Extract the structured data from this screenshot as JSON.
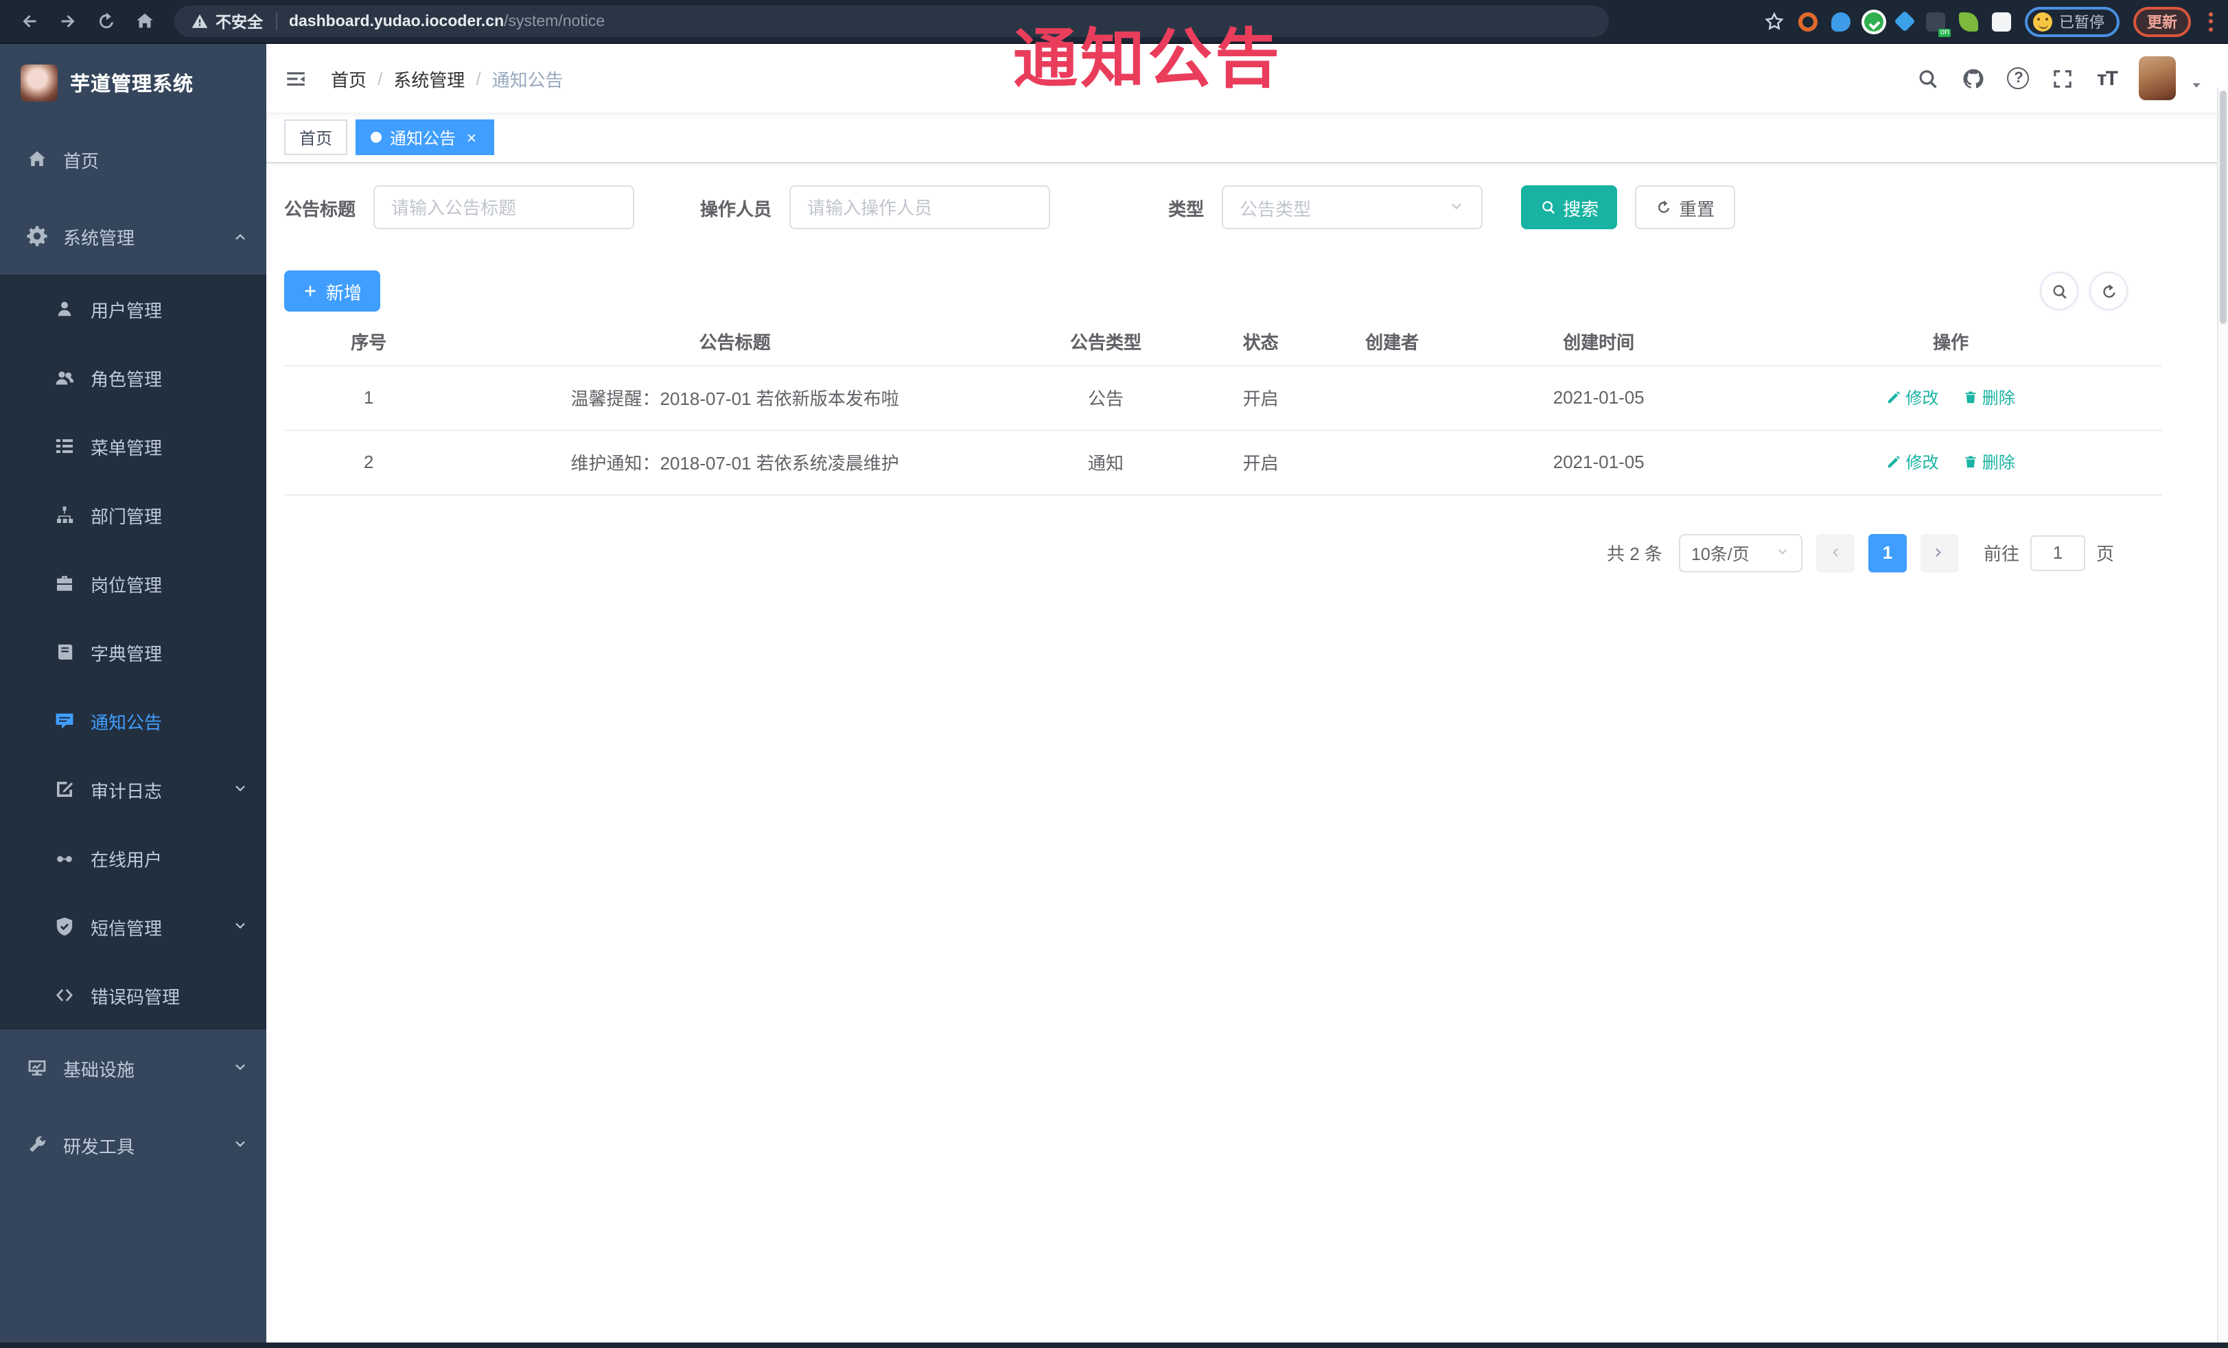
{
  "browser": {
    "security_label": "不安全",
    "url_host": "dashboard.yudao.iocoder.cn",
    "url_path": "/system/notice",
    "paused_label": "已暂停",
    "update_label": "更新"
  },
  "watermark": "通知公告",
  "sidebar": {
    "title": "芋道管理系统",
    "items": [
      {
        "label": "首页",
        "icon": "home-icon"
      },
      {
        "label": "系统管理",
        "icon": "gear-icon",
        "state": "expanded"
      },
      {
        "label": "用户管理",
        "icon": "user-icon"
      },
      {
        "label": "角色管理",
        "icon": "users-icon"
      },
      {
        "label": "菜单管理",
        "icon": "menu-list-icon"
      },
      {
        "label": "部门管理",
        "icon": "org-tree-icon"
      },
      {
        "label": "岗位管理",
        "icon": "post-icon"
      },
      {
        "label": "字典管理",
        "icon": "dict-book-icon"
      },
      {
        "label": "通知公告",
        "icon": "announcement-bubble-icon",
        "state": "active"
      },
      {
        "label": "审计日志",
        "icon": "audit-log-icon",
        "state": "collapsed"
      },
      {
        "label": "在线用户",
        "icon": "online-user-icon"
      },
      {
        "label": "短信管理",
        "icon": "sms-shield-icon",
        "state": "collapsed"
      },
      {
        "label": "错误码管理",
        "icon": "error-code-icon"
      },
      {
        "label": "基础设施",
        "icon": "infrastructure-monitor-icon",
        "state": "collapsed"
      },
      {
        "label": "研发工具",
        "icon": "devtools-icon",
        "state": "collapsed"
      }
    ]
  },
  "navbar": {
    "breadcrumb": {
      "0": "首页",
      "1": "系统管理",
      "2": "通知公告"
    }
  },
  "tabs": [
    {
      "label": "首页",
      "active": false
    },
    {
      "label": "通知公告",
      "active": true
    }
  ],
  "filters": {
    "title_label": "公告标题",
    "title_placeholder": "请输入公告标题",
    "operator_label": "操作人员",
    "operator_placeholder": "请输入操作人员",
    "type_label": "类型",
    "type_placeholder": "公告类型",
    "search_label": "搜索",
    "reset_label": "重置"
  },
  "toolbar": {
    "add_label": "新增"
  },
  "table": {
    "headers": [
      "序号",
      "公告标题",
      "公告类型",
      "状态",
      "创建者",
      "创建时间",
      "操作"
    ],
    "edit_label": "修改",
    "delete_label": "删除",
    "rows": [
      {
        "no": "1",
        "title": "温馨提醒：2018-07-01 若依新版本发布啦",
        "type": "公告",
        "status": "开启",
        "creator": "",
        "created": "2021-01-05"
      },
      {
        "no": "2",
        "title": "维护通知：2018-07-01 若依系统凌晨维护",
        "type": "通知",
        "status": "开启",
        "creator": "",
        "created": "2021-01-05"
      }
    ]
  },
  "pagination": {
    "total": "共 2 条",
    "page_size": "10条/页",
    "current_page": "1",
    "goto_label": "前往",
    "goto_value": "1",
    "page_unit": "页"
  },
  "colors": {
    "accent_blue": "#409EFF",
    "teal": "#18b3a2",
    "watermark_red": "#ea3d5c",
    "sidebar_bg": "#35465c",
    "submenu_bg": "#222f3f",
    "chrome_bg": "#1c2735"
  }
}
